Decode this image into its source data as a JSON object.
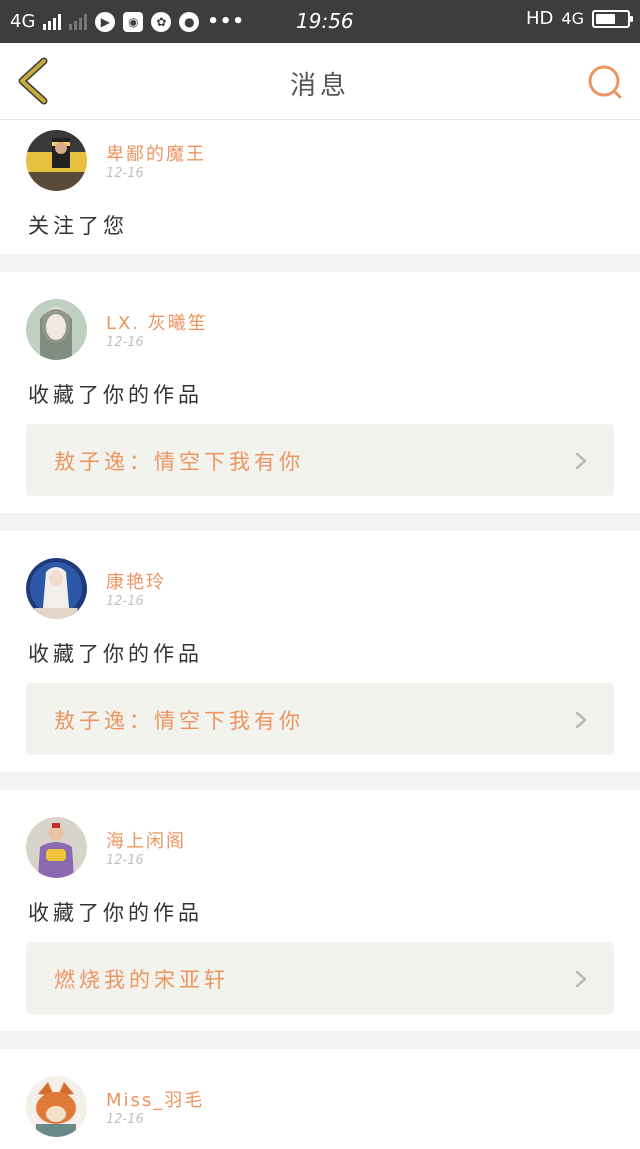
{
  "status_bar": {
    "network": "4G",
    "time": "19:56",
    "hd": "HD",
    "net2": "4G"
  },
  "header": {
    "title": "消息"
  },
  "notifications": [
    {
      "username": "卑鄙的魔王",
      "date": "12-16",
      "action": "关注了您",
      "work": null
    },
    {
      "username": "LX. 灰曦笙",
      "date": "12-16",
      "action": "收藏了你的作品",
      "work": "敖子逸：情空下我有你"
    },
    {
      "username": "康艳玲",
      "date": "12-16",
      "action": "收藏了你的作品",
      "work": "敖子逸：情空下我有你"
    },
    {
      "username": "海上闲阁",
      "date": "12-16",
      "action": "收藏了你的作品",
      "work": "燃烧我的宋亚轩"
    },
    {
      "username": "Miss_羽毛",
      "date": "12-16",
      "action": null,
      "work": null
    }
  ],
  "colors": {
    "accent": "#ec9560",
    "back_arrow": "#c7aa3a",
    "link_bg": "#f3f3ee"
  },
  "icons": {
    "back": "chevron-left-icon",
    "search": "search-icon",
    "link": "chevron-right-icon"
  }
}
